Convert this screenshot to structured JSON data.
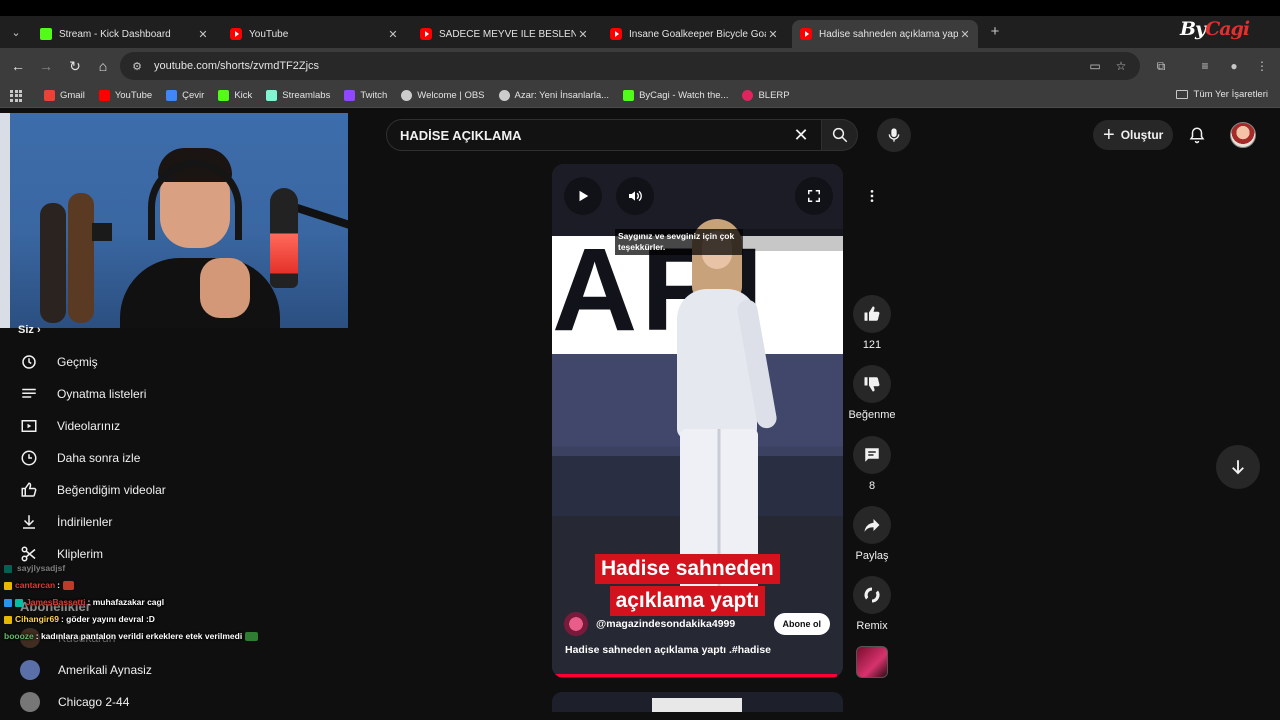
{
  "browser": {
    "tabs": [
      {
        "title": "Stream - Kick Dashboard",
        "icon": "kick-icon",
        "active": false
      },
      {
        "title": "YouTube",
        "icon": "youtube-icon",
        "active": false
      },
      {
        "title": "SADECE MEYVE İLE BESLENENE",
        "icon": "youtube-icon",
        "active": false
      },
      {
        "title": "Insane Goalkeeper Bicycle Goal",
        "icon": "youtube-icon",
        "active": false
      },
      {
        "title": "Hadise sahneden açıklama yaptı",
        "icon": "youtube-icon",
        "active": true
      }
    ],
    "url": "youtube.com/shorts/zvmdTF2Zjcs",
    "bookmarks": [
      {
        "label": "Gmail",
        "color": "#ea4335"
      },
      {
        "label": "YouTube",
        "color": "#ff0000"
      },
      {
        "label": "Çevir",
        "color": "#4285f4"
      },
      {
        "label": "Kick",
        "color": "#53fc18"
      },
      {
        "label": "Streamlabs",
        "color": "#80f5d2"
      },
      {
        "label": "Twitch",
        "color": "#9146ff"
      },
      {
        "label": "Welcome | OBS",
        "color": "#cccccc"
      },
      {
        "label": "Azar: Yeni İnsanlarla...",
        "color": "#cccccc"
      },
      {
        "label": "ByCagi - Watch the...",
        "color": "#53fc18"
      },
      {
        "label": "BLERP",
        "color": "#e0245e"
      }
    ],
    "all_bookmarks": "Tüm Yer İşaretleri"
  },
  "youtube": {
    "search_query": "HADİSE AÇIKLAMA",
    "create_label": "Oluştur",
    "sidebar": {
      "partial_label": "Siz",
      "items": [
        {
          "label": "Geçmiş",
          "icon": "history-icon"
        },
        {
          "label": "Oynatma listeleri",
          "icon": "playlist-icon"
        },
        {
          "label": "Videolarınız",
          "icon": "your-videos-icon"
        },
        {
          "label": "Daha sonra izle",
          "icon": "watch-later-icon"
        },
        {
          "label": "Beğendiğim videolar",
          "icon": "liked-icon"
        },
        {
          "label": "İndirilenler",
          "icon": "download-icon"
        },
        {
          "label": "Kliplerim",
          "icon": "clips-icon"
        }
      ],
      "subscriptions_heading": "Abonelikler",
      "subscriptions": [
        {
          "label": "Kucukaruh",
          "color": "#8b5a3c"
        },
        {
          "label": "Amerikali Aynasiz",
          "color": "#5b6fa8"
        },
        {
          "label": "Chicago 2-44",
          "color": "#777777"
        }
      ]
    },
    "short": {
      "caption_line1": "Saygınız ve sevginiz için çok",
      "caption_line2": "teşekkürler.",
      "backdrop_text": "ARI",
      "title_line1": "Hadise sahneden",
      "title_line2": "açıklama yaptı",
      "channel": "@magazindesondakika4999",
      "subscribe_label": "Abone ol",
      "description": "Hadise sahneden  açıklama yaptı .#hadise"
    },
    "actions": {
      "like_count": "121",
      "dislike_label": "Beğenme",
      "comment_count": "8",
      "share_label": "Paylaş",
      "remix_label": "Remix"
    }
  },
  "chat": [
    {
      "nick": "",
      "message": "sayjlysadjsf",
      "nick_color": "#7cb342",
      "faded": true
    },
    {
      "nick": "cantarcan",
      "message": ":",
      "nick_color": "#e53935",
      "emote": "red"
    },
    {
      "nick": "JamesBassetti",
      "message": ": muhafazakar cagl",
      "nick_color": "#e53935"
    },
    {
      "nick": "Cihangir69",
      "message": ": göder yayını devral :D",
      "nick_color": "#ffd54f"
    },
    {
      "nick": "boooze",
      "message": ": kadınlara pantalon verildi erkeklere etek verilmedi",
      "nick_color": "#66bb6a",
      "emote": "green"
    }
  ],
  "overlay_logo": "By",
  "overlay_logo_accent": "Cagi"
}
